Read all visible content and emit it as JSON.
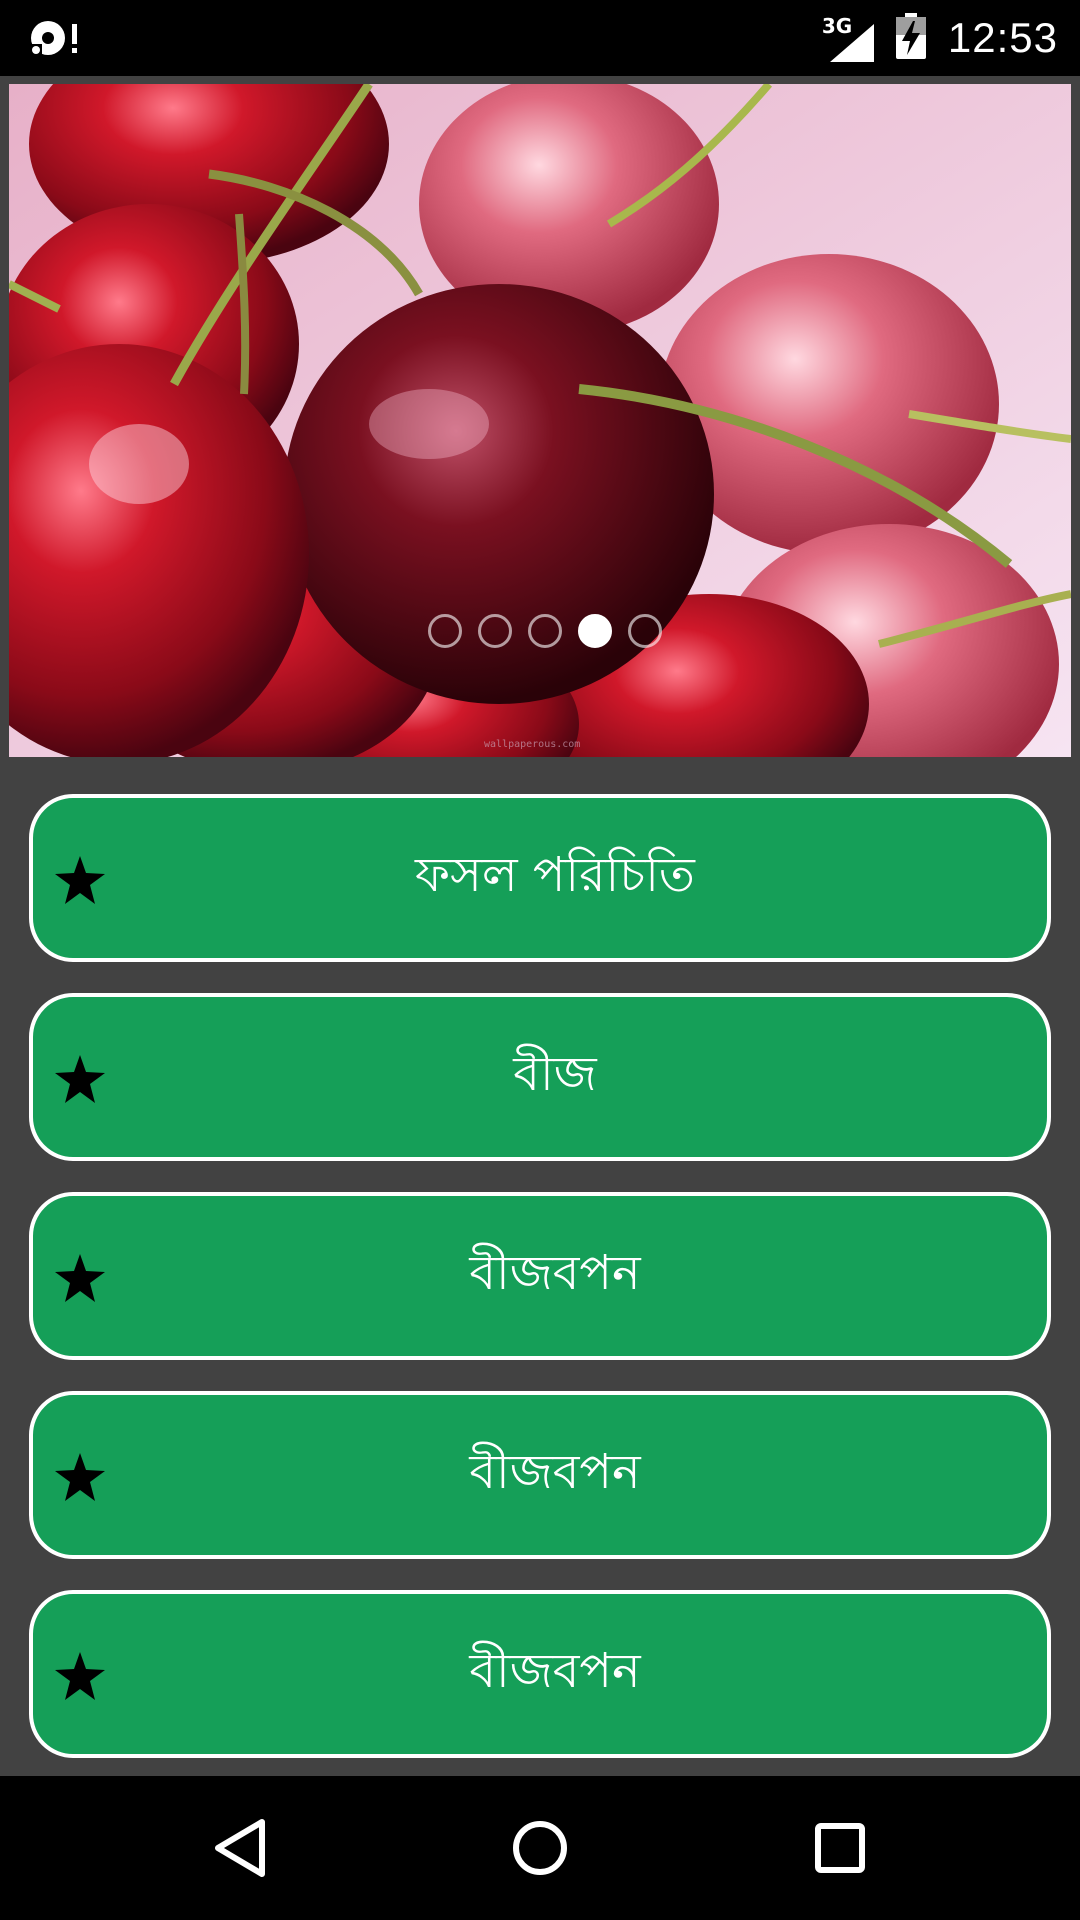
{
  "status_bar": {
    "network": "3G",
    "time": "12:53",
    "icons": [
      "sync-alert-icon",
      "signal-icon",
      "battery-charging-icon"
    ]
  },
  "carousel": {
    "image": "cherries-photo",
    "watermark": "wallpaperous.com",
    "page_count": 5,
    "active_index": 3
  },
  "menu": {
    "items": [
      {
        "label": "ফসল পরিচিতি",
        "icon": "star-icon"
      },
      {
        "label": "বীজ",
        "icon": "star-icon"
      },
      {
        "label": "বীজবপন",
        "icon": "star-icon"
      },
      {
        "label": "বীজবপন",
        "icon": "star-icon"
      },
      {
        "label": "বীজবপন",
        "icon": "star-icon"
      }
    ],
    "colors": {
      "button_bg": "#159f58",
      "button_border": "#ffffff",
      "page_bg": "#424242"
    }
  },
  "nav_bar": {
    "icons": [
      "back-icon",
      "home-icon",
      "recents-icon"
    ]
  }
}
